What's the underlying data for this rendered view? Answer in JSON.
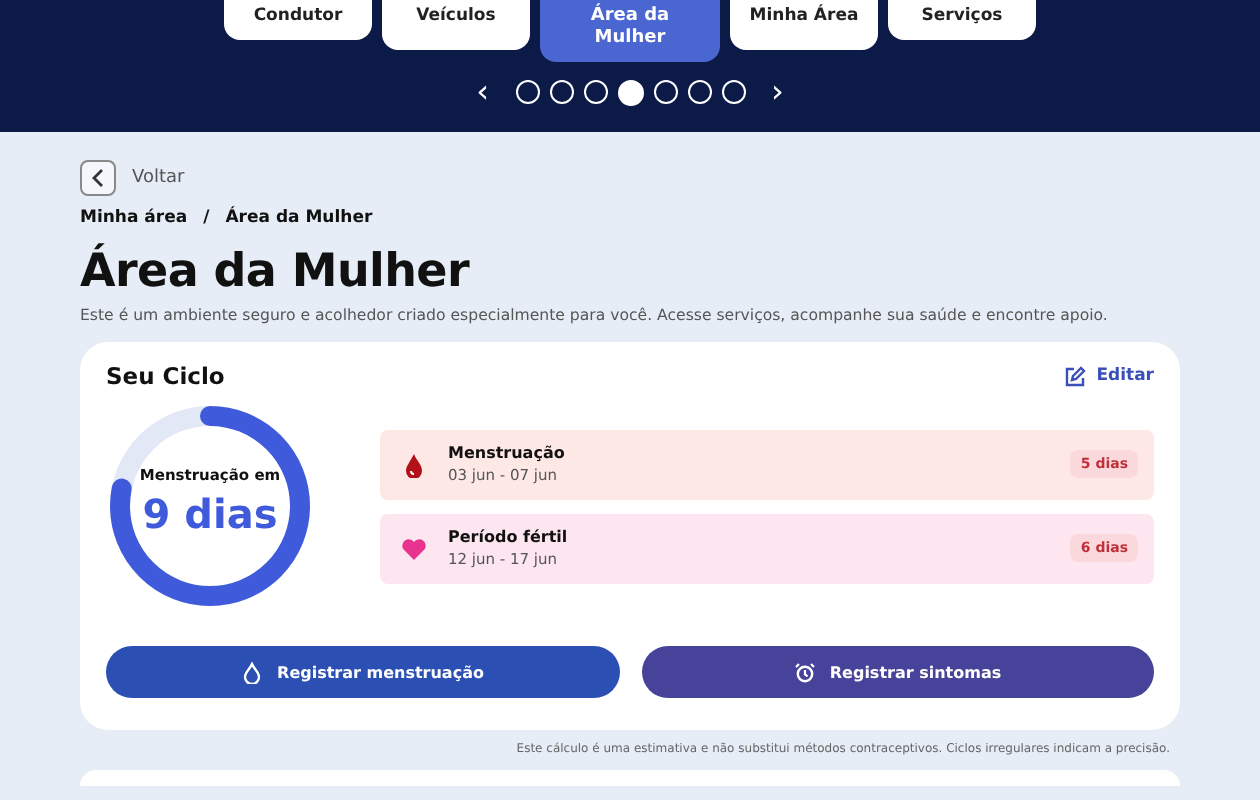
{
  "nav": {
    "tabs": [
      {
        "label": "Condutor",
        "selected": false
      },
      {
        "label": "Veículos",
        "selected": false
      },
      {
        "label": "Área da Mulher",
        "selected": true
      },
      {
        "label": "Minha Área",
        "selected": false
      },
      {
        "label": "Serviços",
        "selected": false
      }
    ],
    "pager": [
      {
        "selected": false
      },
      {
        "selected": false
      },
      {
        "selected": false
      },
      {
        "selected": true
      },
      {
        "selected": false
      },
      {
        "selected": false
      },
      {
        "selected": false
      }
    ],
    "prev": "‹",
    "next": "›"
  },
  "back": {
    "label": "Voltar"
  },
  "breadcrumb": {
    "items": [
      "Minha área",
      "Área da Mulher"
    ],
    "separator": "/"
  },
  "title": "Área da Mulher",
  "description": "Este é um ambiente seguro e acolhedor criado especialmente para você. Acesse serviços, acompanhe sua saúde e encontre apoio.",
  "cycle": {
    "title": "Seu Ciclo",
    "edit": "Editar",
    "ring": {
      "caption": "Menstruação em",
      "value": "9 dias"
    },
    "periods": [
      {
        "kind": "menstruation",
        "name": "Menstruação",
        "dates": "03 jun - 07 jun",
        "duration": "5 dias"
      },
      {
        "kind": "fertile",
        "name": "Período fértil",
        "dates": "12 jun - 17 jun",
        "duration": "6 dias"
      }
    ],
    "actions": [
      {
        "kind": "drop",
        "label": "Registrar menstruação"
      },
      {
        "kind": "alarm",
        "label": "Registrar sintomas"
      }
    ]
  },
  "disclaimer": "Este cálculo é uma estimativa e não substitui métodos contraceptivos. Ciclos irregulares indicam a precisão."
}
